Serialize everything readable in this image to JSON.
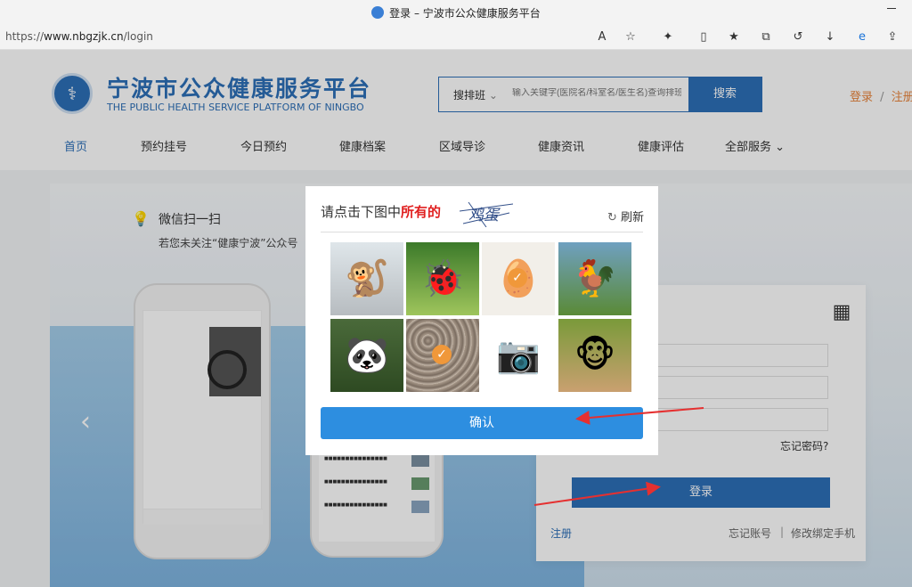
{
  "browser": {
    "tab_title": "登录 – 宁波市公众健康服务平台",
    "url_prefix": "https://",
    "url_host": "www.nbgzjk.cn",
    "url_path": "/login"
  },
  "header": {
    "site_name": "宁波市公众健康服务平台",
    "site_name_en": "THE PUBLIC HEALTH SERVICE PLATFORM OF NINGBO",
    "search_category": "搜排班",
    "search_placeholder": "输入关键字(医院名/科室名/医生名)查询排班",
    "search_button": "搜索",
    "login_link": "登录",
    "separator": "/",
    "register_link": "注册"
  },
  "nav": {
    "items": [
      "首页",
      "预约挂号",
      "今日预约",
      "健康档案",
      "区域导诊",
      "健康资讯",
      "健康评估",
      "全部服务"
    ]
  },
  "banner": {
    "wechat_title": "微信扫一扫",
    "wechat_sub": "若您未关注“健康宁波”公众号"
  },
  "login": {
    "forgot_password": "忘记密码?",
    "login_button": "登录",
    "register": "注册",
    "forgot_account": "忘记账号",
    "divider": "|",
    "change_phone": "修改绑定手机"
  },
  "captcha": {
    "instruction_prefix": "请点击下图中",
    "instruction_highlight": "所有的",
    "target_word": "鸡蛋",
    "refresh": "刷新",
    "confirm": "确认",
    "tiles": [
      {
        "name": "snow-monkey",
        "selected": false
      },
      {
        "name": "ladybug",
        "selected": false
      },
      {
        "name": "eggs",
        "selected": true
      },
      {
        "name": "chickens",
        "selected": false
      },
      {
        "name": "panda",
        "selected": false
      },
      {
        "name": "pebbles",
        "selected": true
      },
      {
        "name": "camera",
        "selected": false
      },
      {
        "name": "monkey-eating",
        "selected": false
      }
    ]
  },
  "colors": {
    "brand_blue": "#2d6fb8",
    "confirm_blue": "#2d8ee0",
    "auth_orange": "#e8833a",
    "highlight_red": "#e02020",
    "annotation_red": "#e53030"
  }
}
